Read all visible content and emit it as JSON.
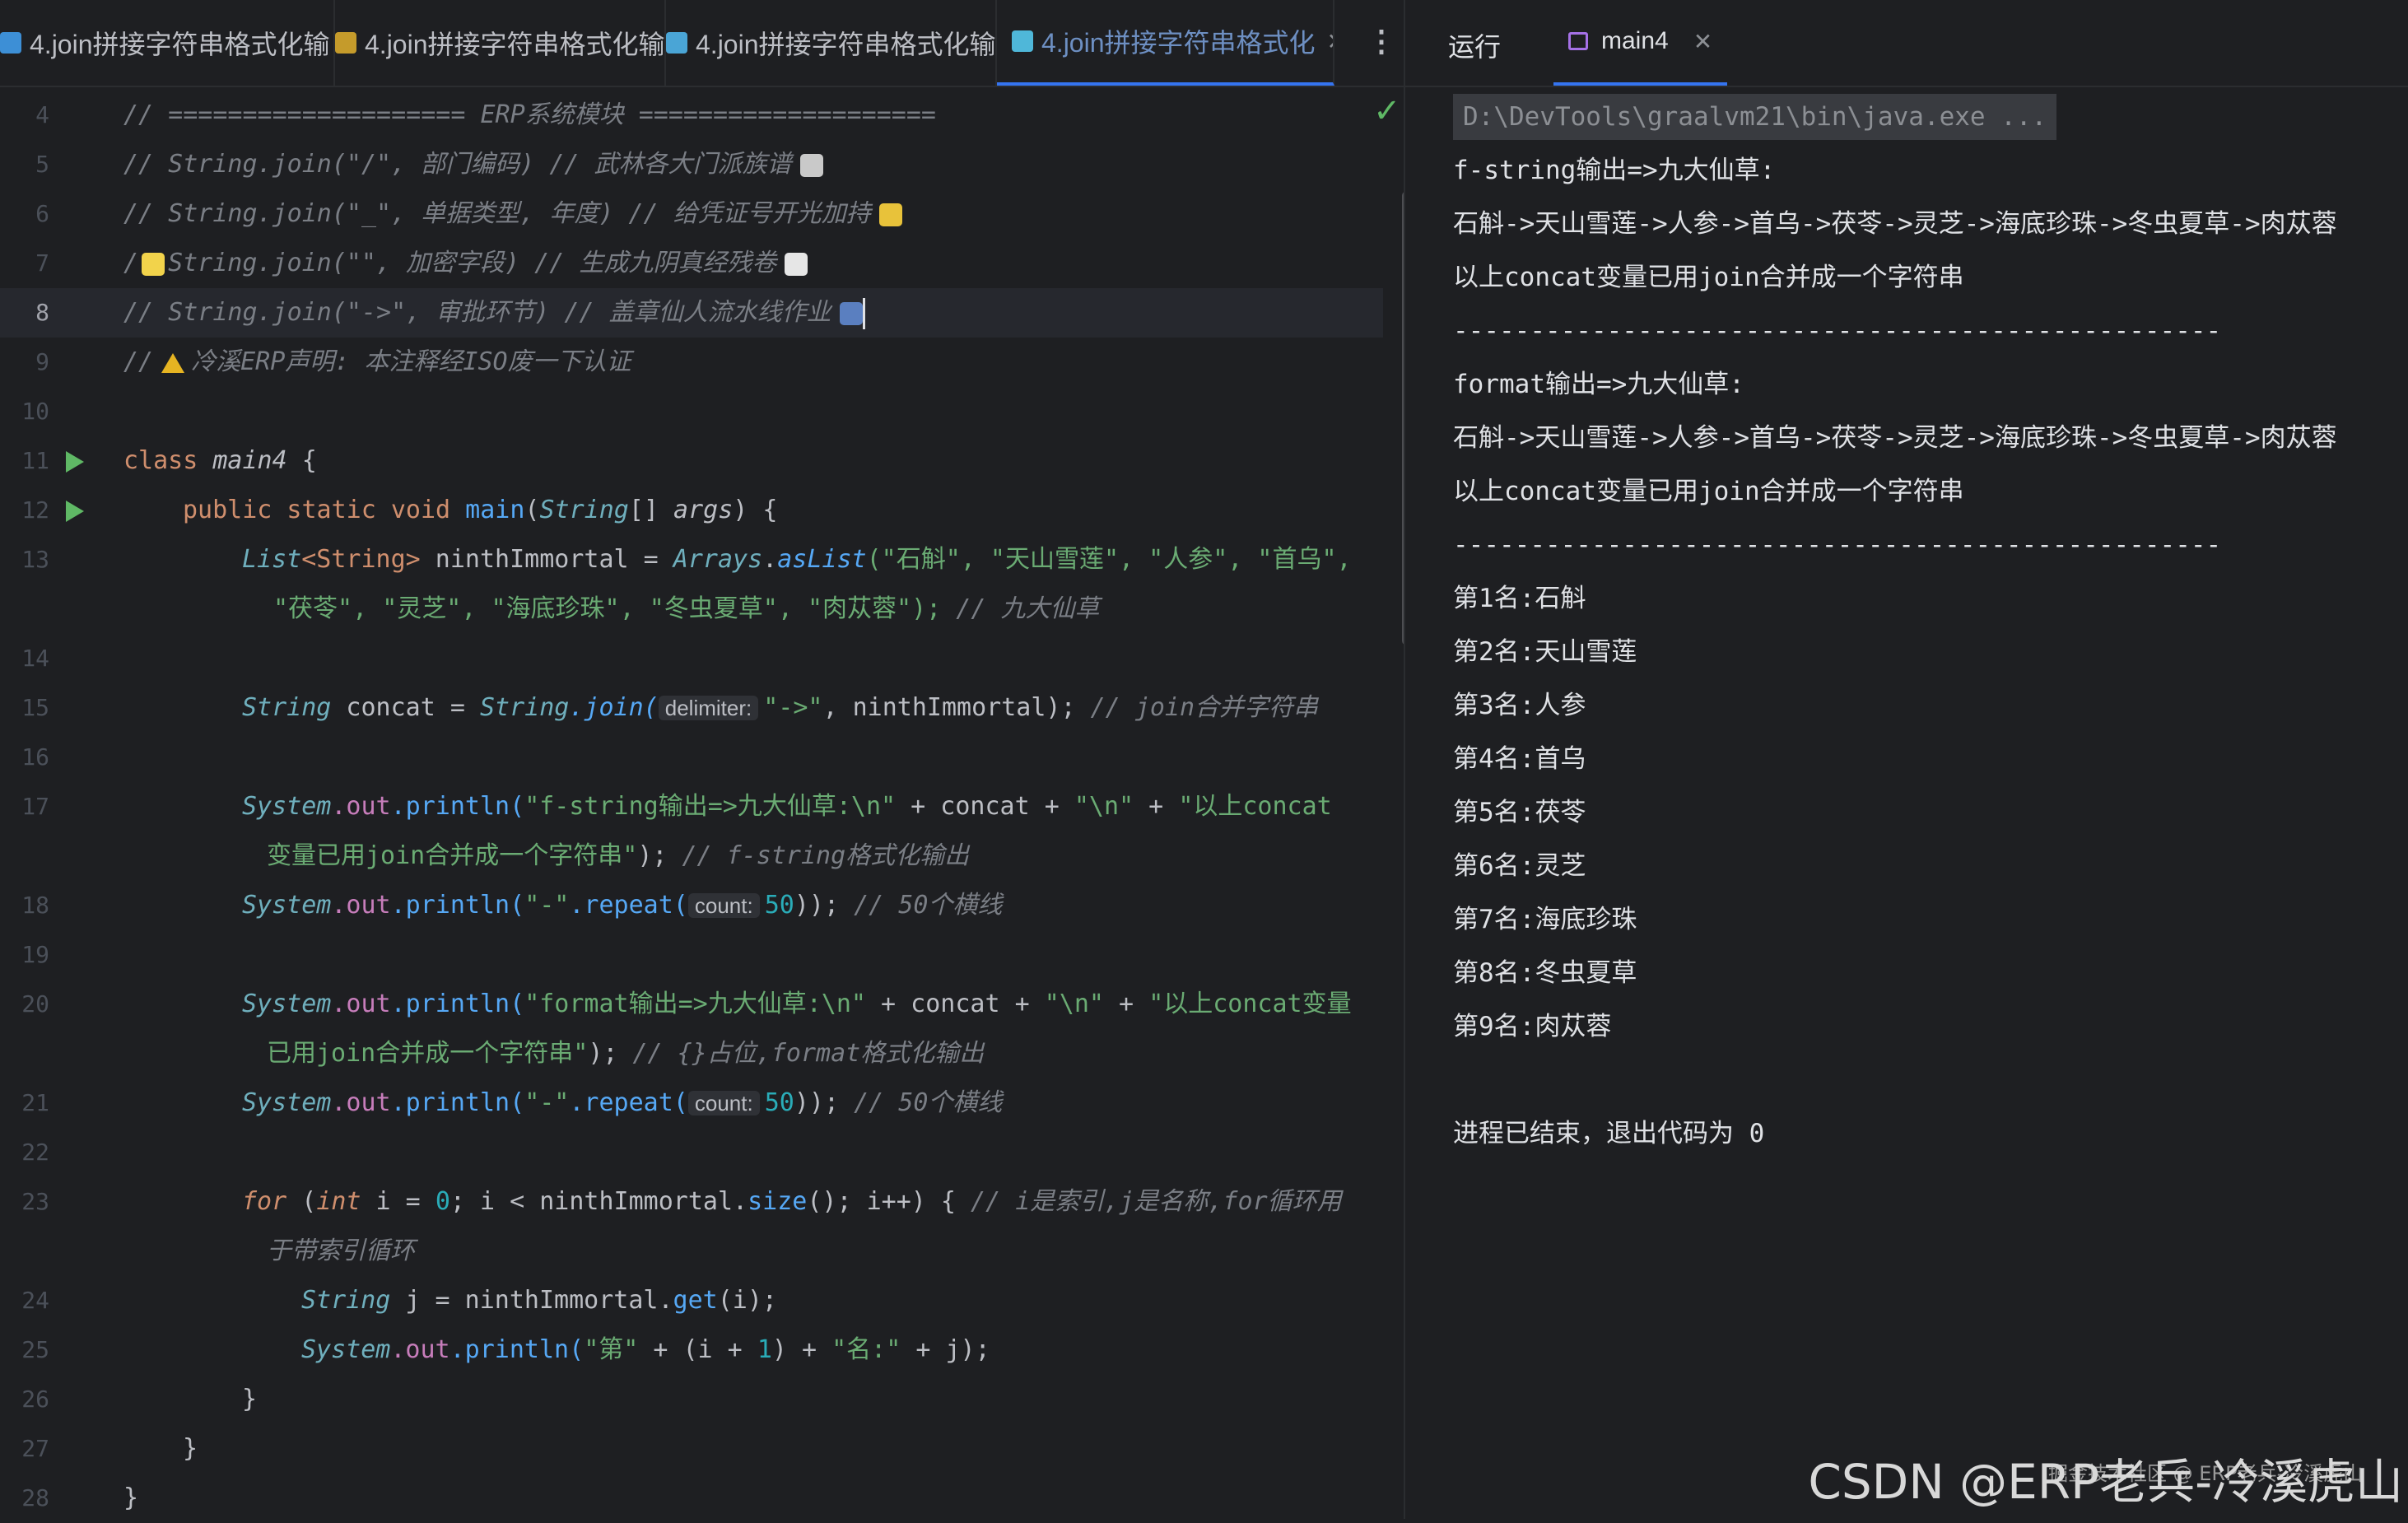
{
  "editor_tabs": [
    {
      "label": "4.join拼接字符串格式化输",
      "icon": "python-file-icon",
      "color": "#3d8fd6",
      "active": false
    },
    {
      "label": "4.join拼接字符串格式化输",
      "icon": "js-file-icon",
      "color": "#c59b2b",
      "active": false
    },
    {
      "label": "4.join拼接字符串格式化输",
      "icon": "go-file-icon",
      "color": "#4aa5d6",
      "active": false
    },
    {
      "label": "4.join拼接字符串格式化",
      "icon": "cube-file-icon",
      "color": "#4fb7d9",
      "active": true
    }
  ],
  "run_panel": {
    "label": "运行",
    "tab": "main4"
  },
  "editor": {
    "line_numbers": [
      "4",
      "5",
      "6",
      "7",
      "8",
      "9",
      "10",
      "11",
      "12",
      "13",
      "",
      "14",
      "15",
      "16",
      "17",
      "",
      "18",
      "19",
      "20",
      "",
      "21",
      "22",
      "23",
      "",
      "24",
      "25",
      "26",
      "27",
      "28"
    ],
    "code": {
      "l4": "// ==================== ERP系统模块 ====================",
      "l5": "// String.join(\"/\", 部门编码)  // 武林各大门派族谱",
      "l6": "// String.join(\"_\", 单据类型, 年度)  // 给凭证号开光加持",
      "l7a": "/",
      "l7b": "String.join(\"\", 加密字段)  // 生成九阴真经残卷",
      "l8": "// String.join(\"->\", 审批环节)  // 盖章仙人流水线作业",
      "l9a": "//",
      "l9b": "冷溪ERP声明: 本注释经ISO废一下认证",
      "l11_kw": "class",
      "l11_name": "main4",
      "l11_brace": " {",
      "l12_mod": "public static void",
      "l12_name": "main",
      "l12_p1": "(",
      "l12_type": "String",
      "l12_arr": "[] ",
      "l12_arg": "args",
      "l12_end": ") {",
      "l13_type": "List",
      "l13_gen": "<String>",
      "l13_var": " ninthImmortal = ",
      "l13_cls": "Arrays",
      "l13_dot": ".",
      "l13_fn": "asList",
      "l13_args": "(\"石斛\", \"天山雪莲\", \"人参\", \"首乌\",",
      "l13b_args": "\"茯苓\", \"灵芝\", \"海底珍珠\", \"冬虫夏草\", \"肉苁蓉\");",
      "l13b_com": " // 九大仙草",
      "l15_type": "String",
      "l15_var": " concat = ",
      "l15_cls": "String",
      "l15_fn": ".join(",
      "l15_hint": "delimiter:",
      "l15_str": "\"->\"",
      "l15_rest": ", ninthImmortal);",
      "l15_com": " // join合并字符串",
      "l17_sys": "System",
      "l17_out": ".out",
      "l17_fn": ".println(",
      "l17_str": "\"f-string输出=>九大仙草:\\n\"",
      "l17_rest": " + concat + ",
      "l17_str2": "\"\\n\"",
      "l17_plus": " + ",
      "l17_str3": "\"以上concat",
      "l17b_str": "变量已用join合并成一个字符串\"",
      "l17b_end": ");",
      "l17b_com": " // f-string格式化输出",
      "l18_sys": "System",
      "l18_out": ".out",
      "l18_fn": ".println(",
      "l18_str": "\"-\"",
      "l18_rep": ".repeat(",
      "l18_hint": "count:",
      "l18_num": "50",
      "l18_end": "));",
      "l18_com": " // 50个横线",
      "l20_sys": "System",
      "l20_out": ".out",
      "l20_fn": ".println(",
      "l20_str": "\"format输出=>九大仙草:\\n\"",
      "l20_rest": " + concat + ",
      "l20_str2": "\"\\n\"",
      "l20_plus": " + ",
      "l20_str3": "\"以上concat变量",
      "l20b_str": "已用join合并成一个字符串\"",
      "l20b_end": ");",
      "l20b_com": " // {}占位,format格式化输出",
      "l21_sys": "System",
      "l21_out": ".out",
      "l21_fn": ".println(",
      "l21_str": "\"-\"",
      "l21_rep": ".repeat(",
      "l21_hint": "count:",
      "l21_num": "50",
      "l21_end": "));",
      "l21_com": " // 50个横线",
      "l23_kw": "for",
      "l23_p": " (",
      "l23_int": "int",
      "l23_rest1": " i = ",
      "l23_zero": "0",
      "l23_rest2": "; i < ninthImmortal.",
      "l23_size": "size",
      "l23_rest3": "(); i++) { ",
      "l23_com": "// i是索引,j是名称,for循环用",
      "l23b_com": "于带索引循环",
      "l24_type": "String",
      "l24_rest": " j = ninthImmortal.",
      "l24_fn": "get",
      "l24_end": "(i);",
      "l25_sys": "System",
      "l25_out": ".out",
      "l25_fn": ".println(",
      "l25_str": "\"第\"",
      "l25_mid": " + (i + ",
      "l25_num": "1",
      "l25_mid2": ") + ",
      "l25_str2": "\"名:\"",
      "l25_end": " + j);",
      "l26": "}",
      "l27": "}",
      "l28": "}"
    }
  },
  "console": {
    "command": "D:\\DevTools\\graalvm21\\bin\\java.exe ...",
    "lines": [
      "f-string输出=>九大仙草:",
      "石斛->天山雪莲->人参->首乌->茯苓->灵芝->海底珍珠->冬虫夏草->肉苁蓉",
      "以上concat变量已用join合并成一个字符串",
      "--------------------------------------------------",
      "format输出=>九大仙草:",
      "石斛->天山雪莲->人参->首乌->茯苓->灵芝->海底珍珠->冬虫夏草->肉苁蓉",
      "以上concat变量已用join合并成一个字符串",
      "--------------------------------------------------",
      "第1名:石斛",
      "第2名:天山雪莲",
      "第3名:人参",
      "第4名:首乌",
      "第5名:茯苓",
      "第6名:灵芝",
      "第7名:海底珍珠",
      "第8名:冬虫夏草",
      "第9名:肉苁蓉"
    ],
    "exit": "进程已结束，退出代码为 0"
  },
  "watermark": {
    "text": "CSDN @ERP老兵-冷溪虎山",
    "small": "掘金技术社区 @ ERP老兵-冷溪虎山"
  }
}
